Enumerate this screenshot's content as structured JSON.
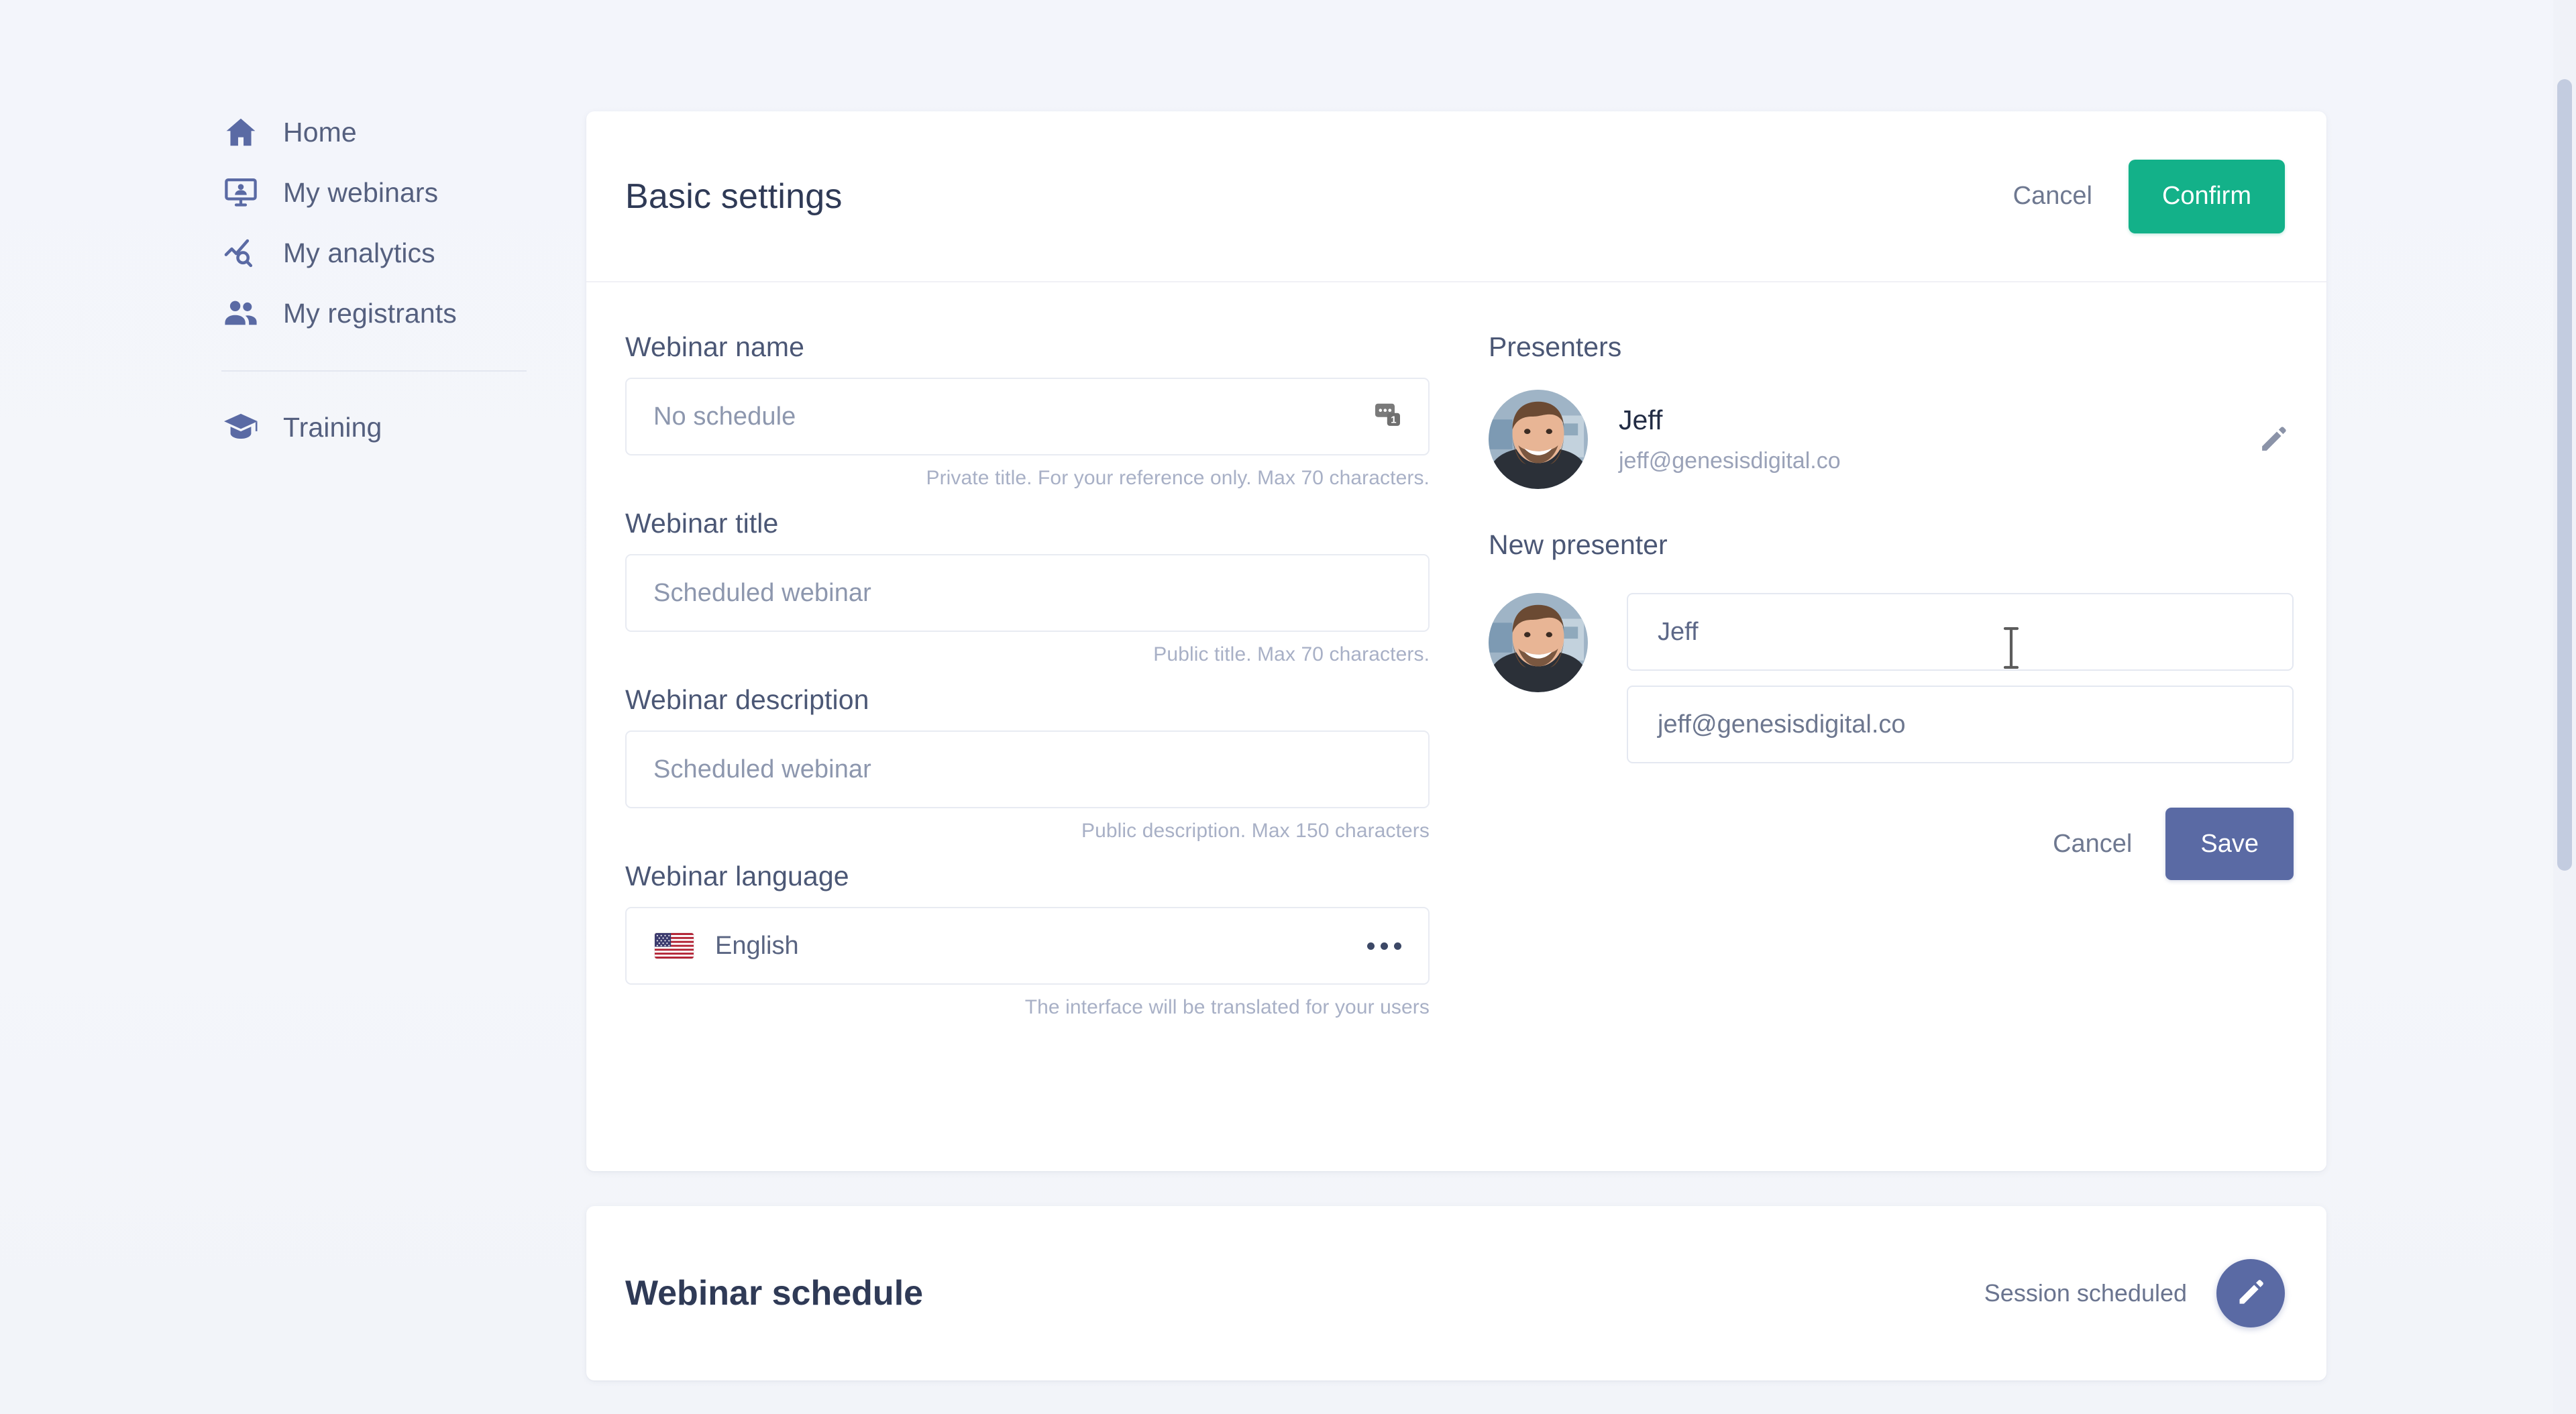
{
  "sidebar": {
    "items": [
      {
        "label": "Home",
        "icon": "home-icon"
      },
      {
        "label": "My webinars",
        "icon": "webinar-screen-icon"
      },
      {
        "label": "My analytics",
        "icon": "analytics-chart-icon"
      },
      {
        "label": "My registrants",
        "icon": "people-icon"
      }
    ],
    "secondary_items": [
      {
        "label": "Training",
        "icon": "graduation-cap-icon"
      }
    ]
  },
  "settings_card": {
    "title": "Basic settings",
    "cancel_label": "Cancel",
    "confirm_label": "Confirm",
    "fields": {
      "webinar_name": {
        "label": "Webinar name",
        "value": "No schedule",
        "placeholder": "No schedule",
        "hint": "Private title. For your reference only. Max 70 characters.",
        "merge_icon": "merge-tags-icon",
        "merge_badge": "1"
      },
      "webinar_title": {
        "label": "Webinar title",
        "value": "Scheduled webinar",
        "placeholder": "Scheduled webinar",
        "hint": "Public title. Max 70 characters."
      },
      "webinar_description": {
        "label": "Webinar description",
        "value": "Scheduled webinar",
        "placeholder": "Scheduled webinar",
        "hint": "Public description. Max 150 characters"
      },
      "webinar_language": {
        "label": "Webinar language",
        "value": "English",
        "flag": "us-flag-icon",
        "menu_icon": "ellipsis-icon",
        "hint": "The interface will be translated for your users"
      }
    },
    "presenters": {
      "section_label": "Presenters",
      "list": [
        {
          "name": "Jeff",
          "email": "jeff@genesisdigital.co",
          "avatar": "presenter-avatar",
          "edit_icon": "pencil-icon"
        }
      ]
    },
    "new_presenter": {
      "section_label": "New presenter",
      "avatar": "presenter-avatar",
      "name_value": "Jeff",
      "name_placeholder": "Name",
      "email_value": "jeff@genesisdigital.co",
      "email_placeholder": "Email",
      "cancel_label": "Cancel",
      "save_label": "Save"
    }
  },
  "schedule_card": {
    "title": "Webinar schedule",
    "status": "Session scheduled",
    "edit_icon": "pencil-icon"
  },
  "colors": {
    "page_bg": "#f4f6fa",
    "card_bg": "#ffffff",
    "accent_green": "#13b189",
    "accent_slate": "#5a6aa4",
    "label_text": "#4b5775",
    "hint_text": "#a8b0c6",
    "scrollbar_thumb": "#c3cce0"
  }
}
